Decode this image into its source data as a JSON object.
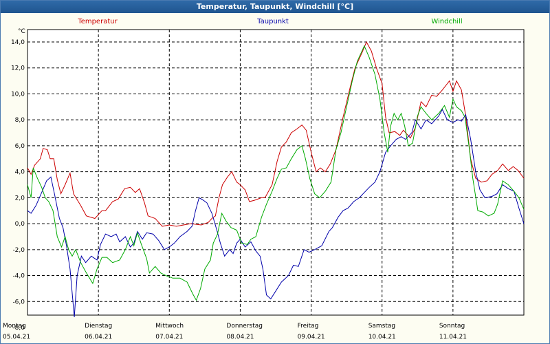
{
  "window": {
    "title": "Temperatur, Taupunkt, Windchill [°C]"
  },
  "colors": {
    "background": "#fdfdf2",
    "titlebar": "#1f5a96",
    "grid": "#000000",
    "temperatur": "#cc0000",
    "taupunkt": "#0000aa",
    "windchill": "#00aa00"
  },
  "chart_data": {
    "type": "line",
    "title": "Temperatur, Taupunkt, Windchill [°C]",
    "ylabel": "°C",
    "ylim": [
      -8,
      14
    ],
    "yticks": [
      "14,0",
      "12,0",
      "10,0",
      "8,0",
      "6,0",
      "4,0",
      "2,0",
      "0,0",
      "-2,0",
      "-4,0",
      "-6,0",
      "-8,0"
    ],
    "xlim": [
      0,
      7
    ],
    "x_day_labels": [
      {
        "day": "Montag",
        "date": "05.04.21"
      },
      {
        "day": "Dienstag",
        "date": "06.04.21"
      },
      {
        "day": "Mittwoch",
        "date": "07.04.21"
      },
      {
        "day": "Donnerstag",
        "date": "08.04.21"
      },
      {
        "day": "Freitag",
        "date": "09.04.21"
      },
      {
        "day": "Samstag",
        "date": "10.04.21"
      },
      {
        "day": "Sonntag",
        "date": "11.04.21"
      }
    ],
    "grid": true,
    "legend": "top",
    "series": [
      {
        "name": "Temperatur",
        "color": "#cc0000",
        "points": [
          [
            0,
            4.3
          ],
          [
            0.05,
            3.8
          ],
          [
            0.1,
            4.5
          ],
          [
            0.18,
            5.0
          ],
          [
            0.22,
            5.8
          ],
          [
            0.28,
            5.7
          ],
          [
            0.32,
            5.0
          ],
          [
            0.37,
            5.0
          ],
          [
            0.42,
            3.4
          ],
          [
            0.47,
            2.3
          ],
          [
            0.53,
            3.0
          ],
          [
            0.6,
            3.9
          ],
          [
            0.65,
            2.3
          ],
          [
            0.75,
            1.4
          ],
          [
            0.83,
            0.6
          ],
          [
            0.95,
            0.4
          ],
          [
            1.05,
            1.0
          ],
          [
            1.1,
            1.0
          ],
          [
            1.2,
            1.7
          ],
          [
            1.28,
            1.9
          ],
          [
            1.37,
            2.7
          ],
          [
            1.45,
            2.8
          ],
          [
            1.52,
            2.4
          ],
          [
            1.58,
            2.7
          ],
          [
            1.65,
            1.6
          ],
          [
            1.7,
            0.6
          ],
          [
            1.8,
            0.4
          ],
          [
            1.9,
            -0.2
          ],
          [
            2.0,
            -0.1
          ],
          [
            2.1,
            -0.2
          ],
          [
            2.2,
            -0.1
          ],
          [
            2.3,
            0.0
          ],
          [
            2.45,
            -0.1
          ],
          [
            2.55,
            0.1
          ],
          [
            2.6,
            0.4
          ],
          [
            2.65,
            0.6
          ],
          [
            2.7,
            2.0
          ],
          [
            2.75,
            3.0
          ],
          [
            2.82,
            3.6
          ],
          [
            2.88,
            4.0
          ],
          [
            2.95,
            3.2
          ],
          [
            3.0,
            3.0
          ],
          [
            3.07,
            2.6
          ],
          [
            3.13,
            1.7
          ],
          [
            3.2,
            1.8
          ],
          [
            3.3,
            2.0
          ],
          [
            3.35,
            2.0
          ],
          [
            3.45,
            3.0
          ],
          [
            3.52,
            4.8
          ],
          [
            3.58,
            5.9
          ],
          [
            3.65,
            6.3
          ],
          [
            3.72,
            7.0
          ],
          [
            3.8,
            7.3
          ],
          [
            3.87,
            7.6
          ],
          [
            3.93,
            7.2
          ],
          [
            4.0,
            5.5
          ],
          [
            4.07,
            4.0
          ],
          [
            4.13,
            4.3
          ],
          [
            4.2,
            4.0
          ],
          [
            4.27,
            4.6
          ],
          [
            4.35,
            5.7
          ],
          [
            4.45,
            8.2
          ],
          [
            4.55,
            10.5
          ],
          [
            4.62,
            12.0
          ],
          [
            4.72,
            13.2
          ],
          [
            4.78,
            14.0
          ],
          [
            4.85,
            13.3
          ],
          [
            4.92,
            12.0
          ],
          [
            5.0,
            10.8
          ],
          [
            5.05,
            8.2
          ],
          [
            5.1,
            7.0
          ],
          [
            5.18,
            7.1
          ],
          [
            5.25,
            6.8
          ],
          [
            5.3,
            7.2
          ],
          [
            5.4,
            6.6
          ],
          [
            5.47,
            7.4
          ],
          [
            5.55,
            9.4
          ],
          [
            5.62,
            9.0
          ],
          [
            5.7,
            9.9
          ],
          [
            5.77,
            9.8
          ],
          [
            5.85,
            10.3
          ],
          [
            5.95,
            11.0
          ],
          [
            6.0,
            10.2
          ],
          [
            6.05,
            11.0
          ],
          [
            6.12,
            10.3
          ],
          [
            6.18,
            8.3
          ],
          [
            6.25,
            5.0
          ],
          [
            6.32,
            3.5
          ],
          [
            6.4,
            3.2
          ],
          [
            6.48,
            3.3
          ],
          [
            6.55,
            3.8
          ],
          [
            6.63,
            4.1
          ],
          [
            6.7,
            4.6
          ],
          [
            6.78,
            4.1
          ],
          [
            6.85,
            4.4
          ],
          [
            6.92,
            4.1
          ],
          [
            7.0,
            3.5
          ]
        ]
      },
      {
        "name": "Taupunkt",
        "color": "#0000aa",
        "points": [
          [
            0,
            1.0
          ],
          [
            0.05,
            0.8
          ],
          [
            0.12,
            1.4
          ],
          [
            0.2,
            2.4
          ],
          [
            0.27,
            3.3
          ],
          [
            0.33,
            3.6
          ],
          [
            0.38,
            2.3
          ],
          [
            0.45,
            0.4
          ],
          [
            0.5,
            -0.3
          ],
          [
            0.55,
            -1.7
          ],
          [
            0.6,
            -3.5
          ],
          [
            0.66,
            -7.2
          ],
          [
            0.7,
            -4.0
          ],
          [
            0.76,
            -2.5
          ],
          [
            0.82,
            -3.0
          ],
          [
            0.9,
            -2.5
          ],
          [
            0.98,
            -2.8
          ],
          [
            1.03,
            -1.6
          ],
          [
            1.1,
            -0.8
          ],
          [
            1.18,
            -1.0
          ],
          [
            1.25,
            -0.8
          ],
          [
            1.3,
            -1.4
          ],
          [
            1.38,
            -1.0
          ],
          [
            1.45,
            -1.8
          ],
          [
            1.5,
            -1.5
          ],
          [
            1.55,
            -0.6
          ],
          [
            1.62,
            -1.2
          ],
          [
            1.68,
            -0.7
          ],
          [
            1.77,
            -0.8
          ],
          [
            1.85,
            -1.3
          ],
          [
            1.93,
            -2.0
          ],
          [
            2.0,
            -1.8
          ],
          [
            2.07,
            -1.5
          ],
          [
            2.15,
            -1.0
          ],
          [
            2.25,
            -0.6
          ],
          [
            2.32,
            -0.2
          ],
          [
            2.37,
            1.0
          ],
          [
            2.42,
            2.0
          ],
          [
            2.48,
            1.8
          ],
          [
            2.53,
            1.6
          ],
          [
            2.6,
            0.8
          ],
          [
            2.67,
            -0.5
          ],
          [
            2.72,
            -1.5
          ],
          [
            2.78,
            -2.5
          ],
          [
            2.85,
            -2.0
          ],
          [
            2.9,
            -2.3
          ],
          [
            2.95,
            -1.5
          ],
          [
            3.0,
            -1.2
          ],
          [
            3.07,
            -1.8
          ],
          [
            3.15,
            -1.4
          ],
          [
            3.22,
            -2.1
          ],
          [
            3.28,
            -2.5
          ],
          [
            3.32,
            -3.5
          ],
          [
            3.37,
            -5.5
          ],
          [
            3.43,
            -5.8
          ],
          [
            3.5,
            -5.2
          ],
          [
            3.58,
            -4.5
          ],
          [
            3.68,
            -4.0
          ],
          [
            3.75,
            -3.2
          ],
          [
            3.82,
            -3.3
          ],
          [
            3.9,
            -2.0
          ],
          [
            3.97,
            -2.2
          ],
          [
            4.05,
            -2.0
          ],
          [
            4.15,
            -1.7
          ],
          [
            4.25,
            -0.6
          ],
          [
            4.3,
            -0.3
          ],
          [
            4.38,
            0.5
          ],
          [
            4.45,
            1.0
          ],
          [
            4.52,
            1.2
          ],
          [
            4.6,
            1.7
          ],
          [
            4.68,
            2.0
          ],
          [
            4.75,
            2.4
          ],
          [
            4.82,
            2.8
          ],
          [
            4.9,
            3.2
          ],
          [
            4.97,
            4.0
          ],
          [
            5.05,
            5.5
          ],
          [
            5.12,
            6.0
          ],
          [
            5.2,
            6.5
          ],
          [
            5.27,
            6.7
          ],
          [
            5.33,
            6.5
          ],
          [
            5.42,
            7.0
          ],
          [
            5.47,
            8.0
          ],
          [
            5.55,
            7.3
          ],
          [
            5.62,
            8.0
          ],
          [
            5.7,
            7.7
          ],
          [
            5.8,
            8.3
          ],
          [
            5.85,
            8.8
          ],
          [
            5.92,
            8.0
          ],
          [
            6.0,
            7.8
          ],
          [
            6.07,
            8.0
          ],
          [
            6.12,
            7.9
          ],
          [
            6.18,
            8.4
          ],
          [
            6.25,
            6.5
          ],
          [
            6.32,
            4.0
          ],
          [
            6.38,
            2.6
          ],
          [
            6.45,
            2.0
          ],
          [
            6.55,
            2.1
          ],
          [
            6.62,
            2.3
          ],
          [
            6.7,
            3.0
          ],
          [
            6.78,
            2.7
          ],
          [
            6.86,
            2.5
          ],
          [
            6.93,
            1.2
          ],
          [
            7.0,
            0.0
          ]
        ]
      },
      {
        "name": "Windchill",
        "color": "#00aa00",
        "points": [
          [
            0,
            3.0
          ],
          [
            0.05,
            2.0
          ],
          [
            0.08,
            4.3
          ],
          [
            0.14,
            3.5
          ],
          [
            0.2,
            2.8
          ],
          [
            0.25,
            2.0
          ],
          [
            0.3,
            1.7
          ],
          [
            0.36,
            1.0
          ],
          [
            0.42,
            -1.0
          ],
          [
            0.48,
            -1.8
          ],
          [
            0.53,
            -1.0
          ],
          [
            0.58,
            -2.0
          ],
          [
            0.63,
            -2.5
          ],
          [
            0.68,
            -2.0
          ],
          [
            0.75,
            -3.0
          ],
          [
            0.82,
            -3.7
          ],
          [
            0.92,
            -4.6
          ],
          [
            0.98,
            -3.5
          ],
          [
            1.05,
            -2.6
          ],
          [
            1.12,
            -2.6
          ],
          [
            1.2,
            -3.0
          ],
          [
            1.3,
            -2.8
          ],
          [
            1.38,
            -2.0
          ],
          [
            1.45,
            -1.0
          ],
          [
            1.5,
            -1.7
          ],
          [
            1.55,
            -0.7
          ],
          [
            1.6,
            -1.5
          ],
          [
            1.68,
            -2.7
          ],
          [
            1.72,
            -3.8
          ],
          [
            1.8,
            -3.3
          ],
          [
            1.88,
            -3.8
          ],
          [
            1.95,
            -4.0
          ],
          [
            2.05,
            -4.2
          ],
          [
            2.15,
            -4.2
          ],
          [
            2.25,
            -4.5
          ],
          [
            2.33,
            -5.4
          ],
          [
            2.38,
            -5.9
          ],
          [
            2.44,
            -5.0
          ],
          [
            2.5,
            -3.5
          ],
          [
            2.58,
            -2.8
          ],
          [
            2.62,
            -1.5
          ],
          [
            2.68,
            -0.8
          ],
          [
            2.74,
            0.8
          ],
          [
            2.8,
            0.2
          ],
          [
            2.87,
            -0.3
          ],
          [
            2.95,
            -0.5
          ],
          [
            3.02,
            -1.5
          ],
          [
            3.1,
            -1.6
          ],
          [
            3.15,
            -1.2
          ],
          [
            3.22,
            -1.0
          ],
          [
            3.3,
            0.5
          ],
          [
            3.37,
            1.5
          ],
          [
            3.45,
            2.5
          ],
          [
            3.52,
            3.5
          ],
          [
            3.58,
            4.2
          ],
          [
            3.65,
            4.3
          ],
          [
            3.72,
            5.0
          ],
          [
            3.8,
            5.7
          ],
          [
            3.87,
            6.0
          ],
          [
            3.92,
            5.0
          ],
          [
            3.98,
            3.5
          ],
          [
            4.05,
            2.3
          ],
          [
            4.12,
            2.0
          ],
          [
            4.2,
            2.5
          ],
          [
            4.28,
            3.2
          ],
          [
            4.35,
            5.7
          ],
          [
            4.42,
            7.0
          ],
          [
            4.5,
            9.0
          ],
          [
            4.58,
            11.0
          ],
          [
            4.65,
            12.5
          ],
          [
            4.75,
            13.7
          ],
          [
            4.82,
            12.8
          ],
          [
            4.9,
            11.5
          ],
          [
            4.97,
            9.6
          ],
          [
            5.03,
            7.0
          ],
          [
            5.08,
            5.5
          ],
          [
            5.12,
            7.5
          ],
          [
            5.17,
            8.5
          ],
          [
            5.22,
            8.0
          ],
          [
            5.27,
            8.5
          ],
          [
            5.32,
            7.5
          ],
          [
            5.37,
            6.0
          ],
          [
            5.43,
            6.2
          ],
          [
            5.5,
            8.3
          ],
          [
            5.55,
            9.0
          ],
          [
            5.62,
            8.5
          ],
          [
            5.7,
            8.0
          ],
          [
            5.8,
            8.5
          ],
          [
            5.88,
            9.1
          ],
          [
            5.95,
            8.2
          ],
          [
            6.0,
            9.6
          ],
          [
            6.05,
            9.0
          ],
          [
            6.12,
            8.7
          ],
          [
            6.17,
            8.2
          ],
          [
            6.23,
            5.8
          ],
          [
            6.28,
            3.5
          ],
          [
            6.35,
            1.0
          ],
          [
            6.42,
            0.9
          ],
          [
            6.5,
            0.6
          ],
          [
            6.58,
            0.8
          ],
          [
            6.63,
            1.5
          ],
          [
            6.7,
            3.3
          ],
          [
            6.78,
            3.0
          ],
          [
            6.86,
            2.5
          ],
          [
            6.93,
            2.0
          ],
          [
            7.0,
            1.1
          ]
        ]
      }
    ]
  }
}
